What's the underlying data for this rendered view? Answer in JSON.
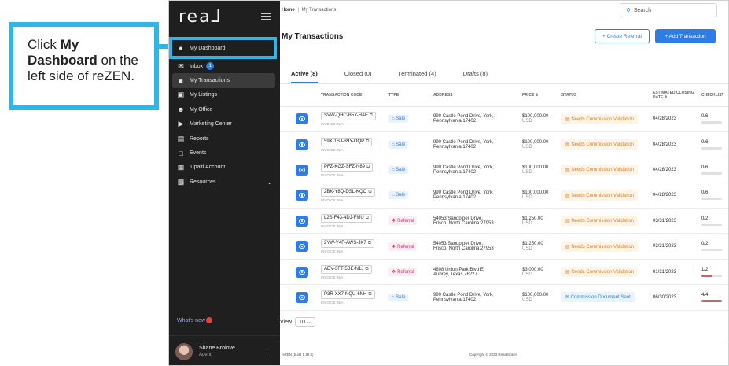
{
  "callout": {
    "prefix": "Click ",
    "bold": "My Dashboard",
    "suffix": " on the left side of reZEN."
  },
  "app": {
    "logo": "rea⅃",
    "sidebar": {
      "items": [
        {
          "label": "My Dashboard",
          "icon": "person-icon"
        },
        {
          "label": "Inbox",
          "icon": "inbox-icon",
          "badge": "1"
        },
        {
          "label": "My Transactions",
          "icon": "document-icon"
        },
        {
          "label": "My Listings",
          "icon": "listing-icon"
        },
        {
          "label": "My Office",
          "icon": "people-icon"
        },
        {
          "label": "Marketing Center",
          "icon": "megaphone-icon"
        },
        {
          "label": "Reports",
          "icon": "report-icon"
        },
        {
          "label": "Events",
          "icon": "calendar-icon"
        },
        {
          "label": "Tipalti Account",
          "icon": "account-icon"
        },
        {
          "label": "Resources",
          "icon": "briefcase-icon"
        }
      ],
      "whats_new": "What's new",
      "user": {
        "name": "Shane Brolove",
        "role": "Agent"
      }
    },
    "breadcrumb": {
      "home": "Home",
      "separator": "|",
      "current": "My Transactions"
    },
    "search_placeholder": "Search",
    "page_title": "My Transactions",
    "buttons": {
      "create_referral": "+ Create Referral",
      "add_transaction": "+ Add Transaction"
    },
    "tabs": [
      "Active (8)",
      "Closed (0)",
      "Terminated (4)",
      "Drafts (8)"
    ],
    "columns": [
      "TRANSACTION CODE",
      "TYPE",
      "ADDRESS",
      "PRICE ⇕",
      "STATUS",
      "ESTIMATED CLOSING DATE ⇕",
      "CHECKLIST"
    ],
    "rows": [
      {
        "code": "SVW-QHC-B5Y-HAF",
        "invoice": "INVOICE: N/A",
        "type": "Sale",
        "addr1": "990 Castle Pond Drive, York,",
        "addr2": "Pennsylvania 17402",
        "price1": "$100,000.00",
        "price2": "USD",
        "status": "Needs Commission Validation",
        "date": "04/28/2023",
        "check": "0/6",
        "progress": 0
      },
      {
        "code": "59X-1SJ-B9Y-OQP",
        "invoice": "INVOICE: N/A",
        "type": "Sale",
        "addr1": "990 Castle Pond Drive, York,",
        "addr2": "Pennsylvania 17402",
        "price1": "$100,000.00",
        "price2": "USD",
        "status": "Needs Commission Validation",
        "date": "04/28/2023",
        "check": "0/6",
        "progress": 0
      },
      {
        "code": "PFZ-KGZ-SFZ-N89",
        "invoice": "INVOICE: N/A",
        "type": "Sale",
        "addr1": "990 Castle Pond Drive, York,",
        "addr2": "Pennsylvania 17402",
        "price1": "$100,000.00",
        "price2": "USD",
        "status": "Needs Commission Validation",
        "date": "04/28/2023",
        "check": "0/6",
        "progress": 0
      },
      {
        "code": "2BK-Y8Q-DSL-KQO",
        "invoice": "INVOICE: N/A",
        "type": "Sale",
        "addr1": "990 Castle Pond Drive, York,",
        "addr2": "Pennsylvania 17402",
        "price1": "$100,000.00",
        "price2": "USD",
        "status": "Needs Commission Validation",
        "date": "04/28/2023",
        "check": "0/6",
        "progress": 0
      },
      {
        "code": "L2S-F43-4DJ-FMU",
        "invoice": "INVOICE: N/A",
        "type": "Referral",
        "addr1": "54053 Sandpiper Drive,",
        "addr2": "Frisco, North Carolina 27953",
        "price1": "$1,250.00",
        "price2": "USD",
        "status": "Needs Commission Validation",
        "date": "03/31/2023",
        "check": "0/2",
        "progress": 0
      },
      {
        "code": "2YW-Y4F-AWS-JK7",
        "invoice": "INVOICE: N/A",
        "type": "Referral",
        "addr1": "54053 Sandpiper Drive,",
        "addr2": "Frisco, North Carolina 27953",
        "price1": "$1,250.00",
        "price2": "USD",
        "status": "Needs Commission Validation",
        "date": "03/31/2023",
        "check": "0/2",
        "progress": 0
      },
      {
        "code": "ADV-3FT-5BE-N1J",
        "invoice": "INVOICE: N/A",
        "type": "Referral",
        "addr1": "4808 Union Park Blvd E,",
        "addr2": "Aubrey, Texas 76227",
        "price1": "$3,000.00",
        "price2": "USD",
        "status": "Needs Commission Validation",
        "date": "01/31/2023",
        "check": "1/2",
        "progress": 0.5
      },
      {
        "code": "P3R-XX7-NQU-6NH",
        "invoice": "INVOICE: N/A",
        "type": "Sale",
        "addr1": "990 Castle Pond Drive, York,",
        "addr2": "Pennsylvania 17402",
        "price1": "$100,000.00",
        "price2": "USD",
        "status": "Commission Document Sent",
        "date": "06/30/2023",
        "check": "4/4",
        "progress": 1
      }
    ],
    "view": {
      "label": "View",
      "value": "10"
    },
    "footer": {
      "build": "reZEN (build 1.19.8)",
      "copyright": "Copyright © 2023 Real Broker"
    }
  }
}
